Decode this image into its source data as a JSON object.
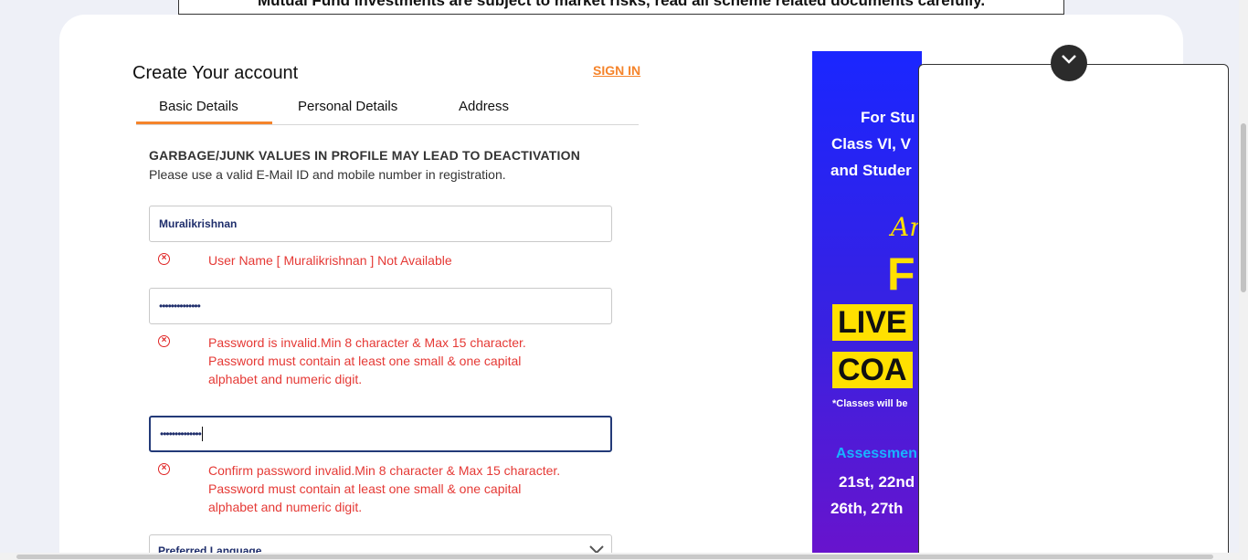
{
  "disclaimer": "Mutual Fund investments are subject to market risks, read all scheme related documents carefully.",
  "form": {
    "title": "Create Your account",
    "signin_label": "SIGN IN",
    "tabs": [
      "Basic Details",
      "Personal Details",
      "Address"
    ],
    "warning_title": "GARBAGE/JUNK VALUES IN PROFILE MAY LEAD TO DEACTIVATION",
    "warning_sub": "Please use a valid E-Mail ID and mobile number in registration.",
    "username_value": "Muralikrishnan",
    "username_error": "User Name [ Muralikrishnan ] Not Available",
    "password_value": "••••••••••••••",
    "password_error": [
      "Password is invalid.Min 8 character & Max 15 character.",
      "Password must contain at least one small & one capital",
      "alphabet and numeric digit."
    ],
    "confirm_value": "••••••••••••••",
    "confirm_error": [
      "Confirm password invalid.Min 8 character & Max 15 character.",
      "Password must contain at least one small & one capital",
      "alphabet and numeric digit."
    ],
    "language_selected": "Preferred Language"
  },
  "ad": {
    "line1": "For Stu",
    "line2": "Class VI, V",
    "line3": "and Studer",
    "script": "An",
    "big": "F",
    "box1": "LIVE",
    "box2": "COA",
    "note": "*Classes will be",
    "assessment": "Assessmen",
    "dates1": "21st, 22nd",
    "dates2": "26th, 27th"
  },
  "colors": {
    "accent": "#f5842b",
    "error": "#e53935",
    "field_text": "#1e2d6b"
  }
}
